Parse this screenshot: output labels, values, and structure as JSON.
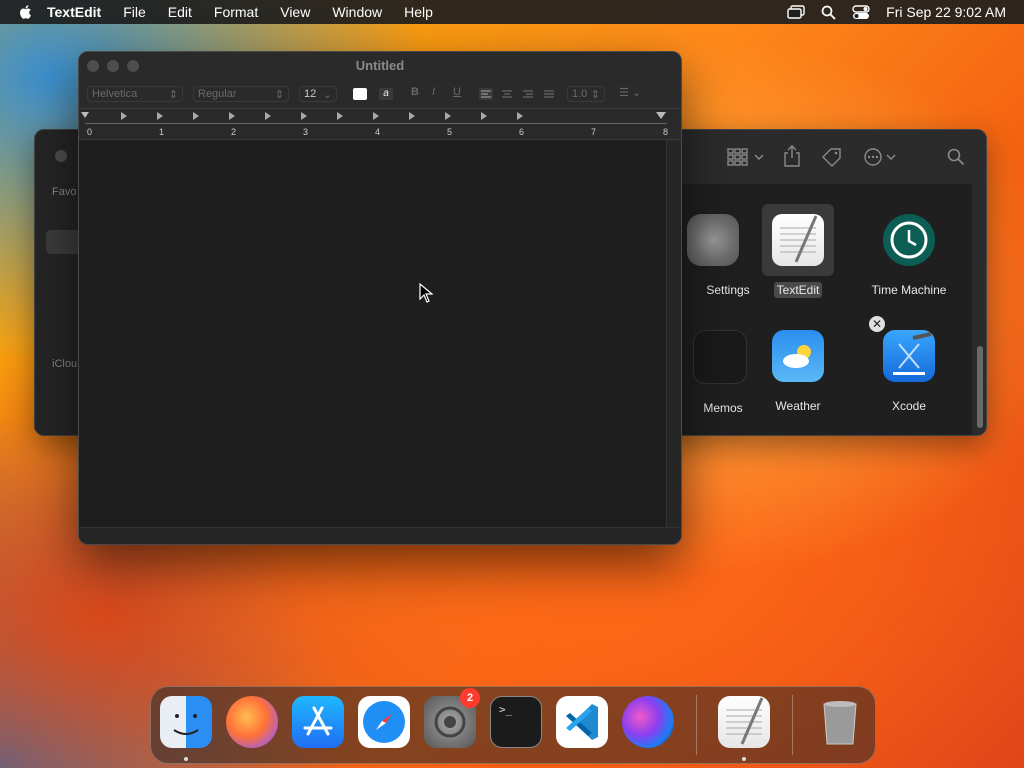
{
  "menubar": {
    "app_name": "TextEdit",
    "items": [
      "File",
      "Edit",
      "Format",
      "View",
      "Window",
      "Help"
    ],
    "datetime": "Fri Sep 22  9:02 AM"
  },
  "textedit": {
    "title": "Untitled",
    "font_family": "Helvetica",
    "font_style": "Regular",
    "font_size": "12",
    "bold": "B",
    "italic": "I",
    "underline": "U",
    "line_spacing": "1.0",
    "ruler_numbers": [
      "0",
      "1",
      "2",
      "3",
      "4",
      "5",
      "6",
      "7",
      "8"
    ]
  },
  "finder": {
    "sidebar_labels": [
      "Favo",
      "iClou"
    ],
    "apps": [
      {
        "label": "Settings"
      },
      {
        "label": "TextEdit"
      },
      {
        "label": "Time Machine"
      },
      {
        "label": "Memos"
      },
      {
        "label": "Weather"
      },
      {
        "label": "Xcode"
      }
    ]
  },
  "dock": {
    "items": [
      "finder",
      "firefox",
      "app-store",
      "safari",
      "system-settings",
      "terminal",
      "vscode",
      "siri",
      "textedit",
      "trash"
    ],
    "settings_badge": "2"
  }
}
